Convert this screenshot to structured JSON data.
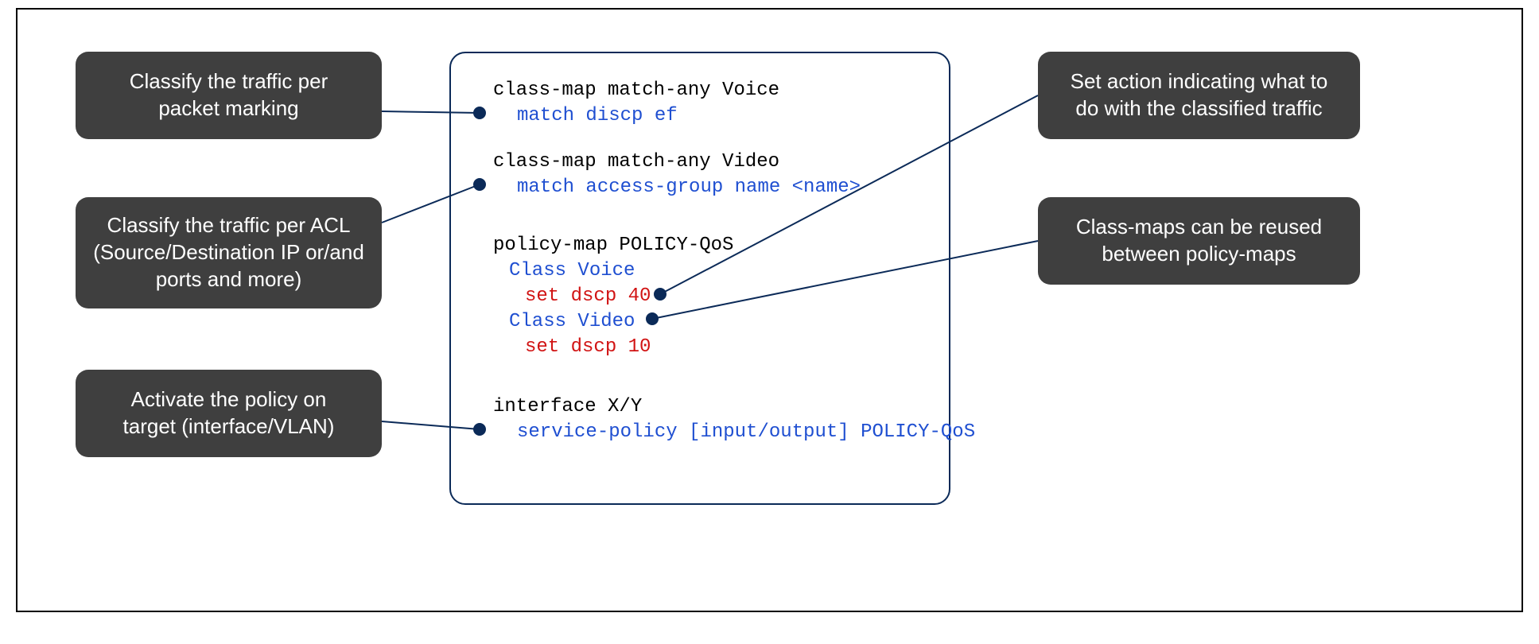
{
  "callouts": {
    "left1": "Classify the traffic per\npacket marking",
    "left2": "Classify the traffic per ACL\n(Source/Destination IP or/and\nports and more)",
    "left3": "Activate the policy on\ntarget (interface/VLAN)",
    "right1": "Set action indicating what to\ndo with the classified traffic",
    "right2": "Class-maps can be reused\nbetween policy-maps"
  },
  "code": {
    "l1": "class-map match-any Voice",
    "l2": "match discp ef",
    "l3": "class-map match-any Video",
    "l4": "match access-group name <name>",
    "l5": "policy-map POLICY-QoS",
    "l6": "Class Voice",
    "l7": "set dscp 40",
    "l8": "Class Video",
    "l9": "set dscp 10",
    "l10": "interface X/Y",
    "l11": "service-policy [input/output] POLICY-QoS"
  },
  "colors": {
    "callout_bg": "#3f3f3f",
    "border": "#0b2a58",
    "code_blue": "#1f4fd1",
    "code_red": "#d11313"
  }
}
